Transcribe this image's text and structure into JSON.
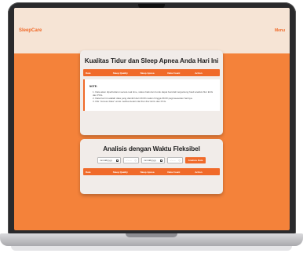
{
  "app": {
    "brand": "SleepCare",
    "menu_label": "Menu"
  },
  "card1": {
    "title": "Kualitas Tidur dan Sleep Apnea Anda Hari Ini",
    "columns": [
      "Date",
      "Sleep Quality",
      "Sleep Apnea",
      "Data Count",
      "Action"
    ],
    "note_title": "NOTE:",
    "notes": [
      "1. Data akan diperbaharui secara real time, status baik dan buruk dapat berubah tergantung hasil analisis fitur ECG dan PCG.",
      "2. Data hari ini adalah data yang diambil dari 20.00 malam hingga 09.00 pagi keesokan harinya.",
      "3. Klik \"Access Data\" untuk melihat detail nilai fitur-fitur ECG dan PCG."
    ]
  },
  "card2": {
    "title": "Analisis dengan Waktu Fleksibel",
    "start_date_placeholder": "mm/dd/yyyy",
    "start_time_placeholder": "--:-- --",
    "end_date_placeholder": "mm/dd/yyyy",
    "end_time_placeholder": "--:-- --",
    "button_label": "Analisis Data",
    "columns": [
      "Date",
      "Sleep Quality",
      "Sleep Apnea",
      "Data Count",
      "Action"
    ]
  },
  "colors": {
    "accent": "#f06a2a",
    "background": "#f4823a",
    "navbar": "#f6e4d5"
  },
  "icons": {
    "date_input": "calendar-icon",
    "time_input": "clock-icon"
  }
}
